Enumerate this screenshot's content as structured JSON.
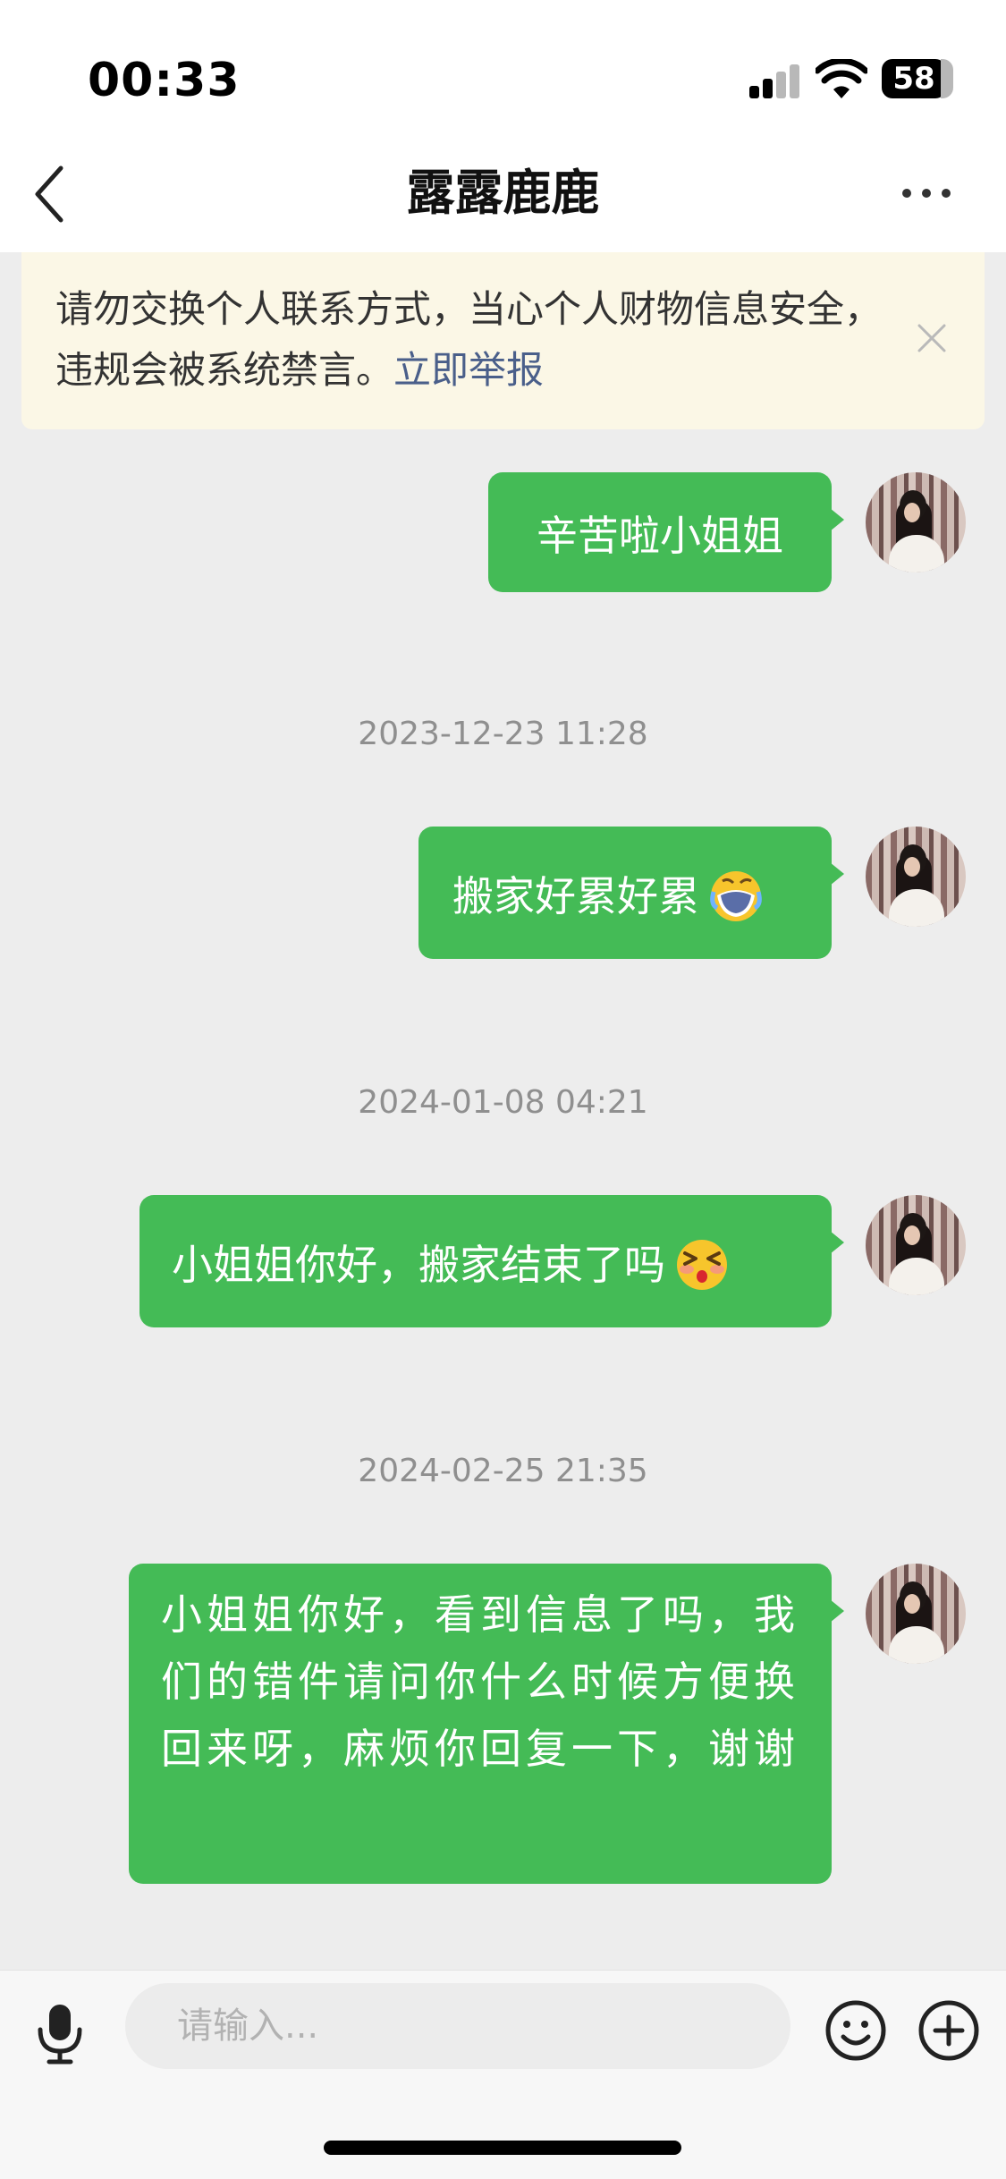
{
  "status_bar": {
    "time": "00:33",
    "battery": "58",
    "icons": [
      "cellular-signal-icon",
      "wifi-icon",
      "battery-icon"
    ]
  },
  "nav": {
    "title": "露露鹿鹿",
    "back_icon": "chevron-left-icon",
    "more_icon": "more-horizontal-icon"
  },
  "notice": {
    "text": "请勿交换个人联系方式，当心个人财物信息安全，违规会被系统禁言。",
    "link": "立即举报",
    "close_icon": "close-icon"
  },
  "messages": [
    {
      "text": "辛苦啦小姐姐"
    },
    {
      "timestamp": "2023-12-23 11:28",
      "text": "搬家好累好累",
      "emoji": "loudly-crying-face-emoji"
    },
    {
      "timestamp": "2024-01-08 04:21",
      "text": "小姐姐你好，搬家结束了吗",
      "emoji": "kissing-squinting-face-emoji"
    },
    {
      "timestamp": "2024-02-25 21:35",
      "text": "小姐姐你好，看到信息了吗，我们的错件请问你什么时候方便换回来呀，麻烦你回复一下，谢谢"
    }
  ],
  "input_bar": {
    "placeholder": "请输入...",
    "voice_icon": "microphone-icon",
    "emoji_icon": "smiley-icon",
    "plus_icon": "plus-circle-icon"
  },
  "colors": {
    "bubble": "#44bb56",
    "background": "#ededed",
    "notice_bg": "#fbf7e6",
    "link": "#4a5f8a"
  }
}
